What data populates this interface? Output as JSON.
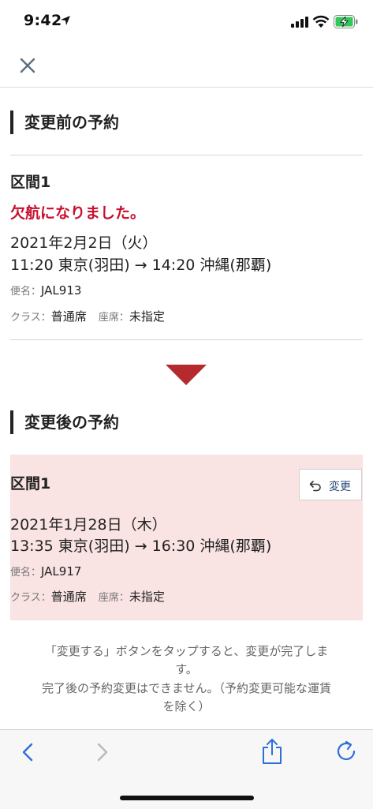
{
  "status_bar": {
    "time": "9:42"
  },
  "before": {
    "heading": "変更前の予約",
    "segment_label": "区間1",
    "cancel_notice": "欠航になりました。",
    "date": "2021年2月2日（火）",
    "route": "11:20 東京(羽田) → 14:20 沖縄(那覇)",
    "flight_label": "便名：",
    "flight_no": "JAL913",
    "class_label": "クラス：",
    "class_value": "普通席",
    "seat_label": "座席：",
    "seat_value": "未指定"
  },
  "after": {
    "heading": "変更後の予約",
    "segment_label": "区間1",
    "undo_label": "変更",
    "date": "2021年1月28日（木）",
    "route": "13:35 東京(羽田) → 16:30 沖縄(那覇)",
    "flight_label": "便名：",
    "flight_no": "JAL917",
    "class_label": "クラス：",
    "class_value": "普通席",
    "seat_label": "座席：",
    "seat_value": "未指定"
  },
  "note": {
    "line1": "「変更する」ボタンをタップすると、変更が完了しま",
    "line2": "す。",
    "line3": "完了後の予約変更はできません。（予約変更可能な運賃",
    "line4": "を除く）"
  },
  "colors": {
    "accent_red": "#c8102e",
    "arrow_red": "#b52a2f",
    "card_bg": "#f9e3e3",
    "link_blue": "#2c4a7a"
  },
  "icons": [
    "location-arrow-icon",
    "signal-icon",
    "wifi-icon",
    "battery-charging-icon",
    "close-icon",
    "down-triangle-icon",
    "undo-icon",
    "back-icon",
    "forward-icon",
    "share-icon",
    "reload-icon"
  ]
}
